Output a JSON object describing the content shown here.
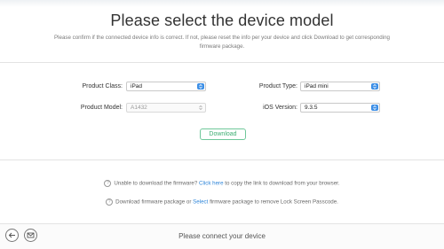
{
  "header": {
    "title": "Please select the device model",
    "subtitle": "Please confirm if the connected device info is correct. If not, please reset the info per your device and click Download to get corresponding firmware package."
  },
  "form": {
    "product_class": {
      "label": "Product Class:",
      "value": "iPad"
    },
    "product_type": {
      "label": "Product Type:",
      "value": "iPad mini"
    },
    "product_model": {
      "label": "Product Model:",
      "value": "A1432"
    },
    "ios_version": {
      "label": "iOS Version:",
      "value": "9.3.5"
    }
  },
  "download_button": "Download",
  "help": {
    "line1_before": "Unable to download the firmware?",
    "line1_link": "Click here",
    "line1_after": "to copy the link to download from your browser.",
    "line2_before": "Download firmware package or",
    "line2_link": "Select",
    "line2_after": "firmware package to remove Lock Screen Passcode."
  },
  "footer": {
    "status": "Please connect your device"
  },
  "colors": {
    "accent_blue": "#3d8fe6",
    "link_blue": "#2f86d9",
    "download_green": "#3fae73"
  }
}
